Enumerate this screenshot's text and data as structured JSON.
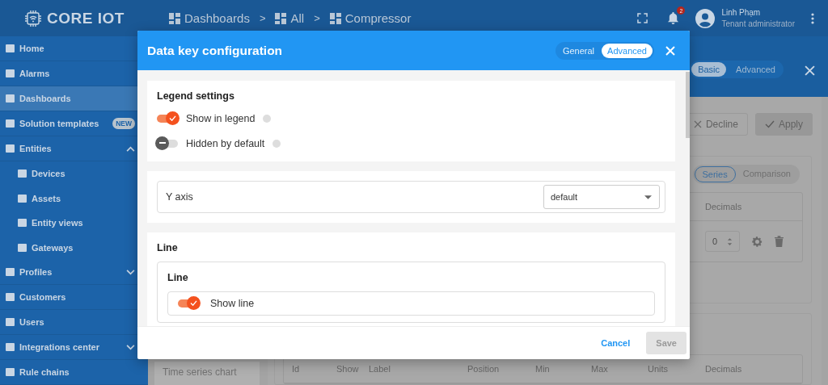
{
  "header": {
    "logo": "CORE IOT",
    "breadcrumbs": [
      "Dashboards",
      "All",
      "Compressor"
    ],
    "separators": [
      ">",
      ">"
    ],
    "notification_count": "2",
    "user_name": "Linh Phạm",
    "user_role": "Tenant administrator"
  },
  "sidebar": {
    "items": [
      {
        "label": "Home",
        "selected": false
      },
      {
        "label": "Alarms",
        "selected": false
      },
      {
        "label": "Dashboards",
        "selected": true
      },
      {
        "label": "Solution templates",
        "selected": false,
        "badge": "NEW"
      },
      {
        "label": "Entities",
        "selected": false,
        "expanded": true,
        "children": [
          {
            "label": "Devices",
            "selected": false
          },
          {
            "label": "Assets",
            "selected": false
          },
          {
            "label": "Entity views",
            "selected": false
          },
          {
            "label": "Gateways",
            "selected": false
          }
        ]
      },
      {
        "label": "Profiles",
        "selected": false,
        "expanded": false
      },
      {
        "label": "Customers",
        "selected": false
      },
      {
        "label": "Users",
        "selected": false
      },
      {
        "label": "Integrations center",
        "selected": false,
        "expanded": false
      },
      {
        "label": "Rule chains",
        "selected": false
      }
    ]
  },
  "editor": {
    "mode_tabs": [
      {
        "label": "Basic",
        "selected": true
      },
      {
        "label": "Advanced",
        "selected": false
      }
    ],
    "actions": [
      {
        "label": "Decline",
        "kind": "decline"
      },
      {
        "label": "Apply",
        "kind": "apply"
      }
    ],
    "series_tabs": [
      {
        "label": "Series",
        "selected": true
      },
      {
        "label": "Comparison",
        "selected": false
      }
    ],
    "series_table": {
      "column": "Decimals",
      "decimals": "0"
    },
    "widget_tile": "Time series chart",
    "columns": [
      "Id",
      "Show",
      "Label",
      "Position",
      "Min",
      "Max",
      "Units",
      "Decimals"
    ]
  },
  "dialog": {
    "title": "Data key configuration",
    "tabs": [
      {
        "label": "General",
        "selected": false
      },
      {
        "label": "Advanced",
        "selected": true
      }
    ],
    "legend": {
      "title": "Legend settings",
      "toggles": [
        {
          "label": "Show in legend",
          "on": true
        },
        {
          "label": "Hidden by default",
          "on": false
        }
      ]
    },
    "y_axis": {
      "label": "Y axis",
      "value": "default"
    },
    "line": {
      "title": "Line",
      "subtitle": "Line",
      "toggle": {
        "label": "Show line",
        "on": true
      }
    },
    "buttons": [
      {
        "label": "Cancel",
        "kind": "cancel",
        "disabled": false
      },
      {
        "label": "Save",
        "kind": "save",
        "disabled": true
      }
    ]
  }
}
